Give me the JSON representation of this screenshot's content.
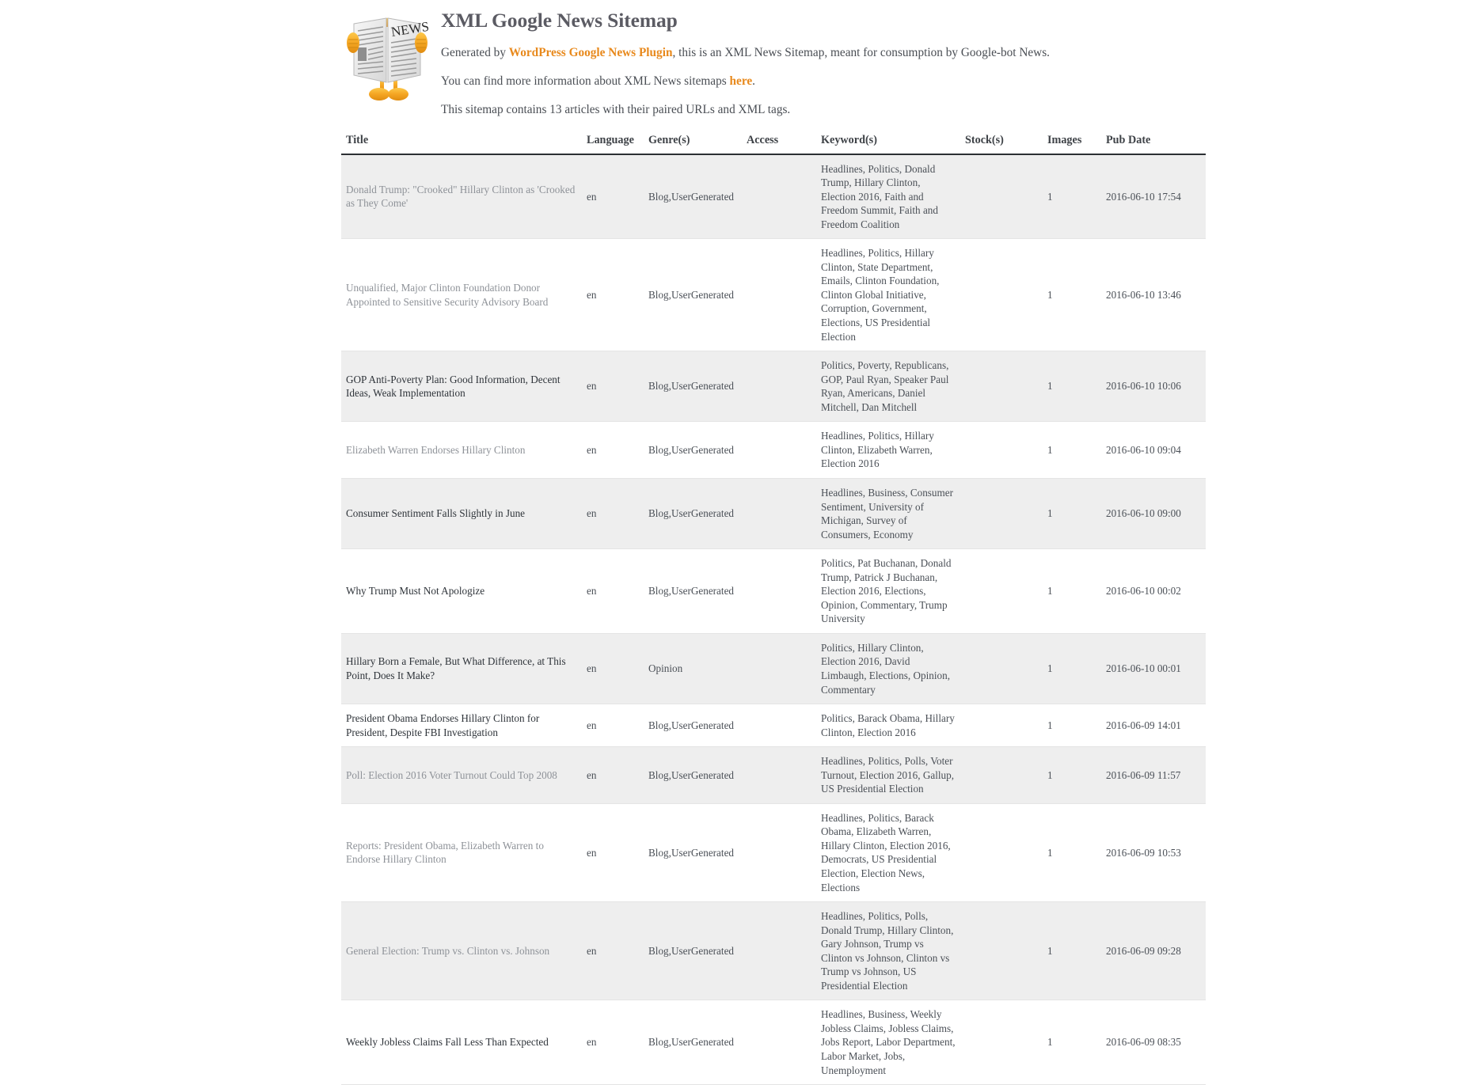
{
  "header": {
    "title": "XML Google News Sitemap",
    "mascot_alt": "news-mascot",
    "generated_prefix": "Generated by ",
    "generated_link": "WordPress Google News Plugin",
    "generated_suffix": ", this is an XML News Sitemap, meant for consumption by Google-bot News.",
    "more_info_prefix": "You can find more information about XML News sitemaps ",
    "more_info_link": "here",
    "more_info_suffix": ".",
    "count_line": "This sitemap contains 13 articles with their paired URLs and XML tags.",
    "accent_color": "#e8891c",
    "heading_color": "#5b5b63"
  },
  "table": {
    "columns": [
      "Title",
      "Language",
      "Genre(s)",
      "Access",
      "Keyword(s)",
      "Stock(s)",
      "Images",
      "Pub Date"
    ],
    "rows": [
      {
        "title": "Donald Trump: \"Crooked\" Hillary Clinton as 'Crooked as They Come'",
        "visited": true,
        "language": "en",
        "genres": "Blog,UserGenerated",
        "access": "",
        "keywords": "Headlines, Politics, Donald Trump, Hillary Clinton, Election 2016, Faith and Freedom Summit, Faith and Freedom Coalition",
        "stocks": "",
        "images": "1",
        "pub_date": "2016-06-10 17:54"
      },
      {
        "title": "Unqualified, Major Clinton Foundation Donor Appointed to Sensitive Security Advisory Board",
        "visited": true,
        "language": "en",
        "genres": "Blog,UserGenerated",
        "access": "",
        "keywords": "Headlines, Politics, Hillary Clinton, State Department, Emails, Clinton Foundation, Clinton Global Initiative, Corruption, Government, Elections, US Presidential Election",
        "stocks": "",
        "images": "1",
        "pub_date": "2016-06-10 13:46"
      },
      {
        "title": "GOP Anti-Poverty Plan: Good Information, Decent Ideas, Weak Implementation",
        "visited": false,
        "language": "en",
        "genres": "Blog,UserGenerated",
        "access": "",
        "keywords": "Politics, Poverty, Republicans, GOP, Paul Ryan, Speaker Paul Ryan, Americans, Daniel Mitchell, Dan Mitchell",
        "stocks": "",
        "images": "1",
        "pub_date": "2016-06-10 10:06"
      },
      {
        "title": "Elizabeth Warren Endorses Hillary Clinton",
        "visited": true,
        "language": "en",
        "genres": "Blog,UserGenerated",
        "access": "",
        "keywords": "Headlines, Politics, Hillary Clinton, Elizabeth Warren, Election 2016",
        "stocks": "",
        "images": "1",
        "pub_date": "2016-06-10 09:04"
      },
      {
        "title": "Consumer Sentiment Falls Slightly in June",
        "visited": false,
        "language": "en",
        "genres": "Blog,UserGenerated",
        "access": "",
        "keywords": "Headlines, Business, Consumer Sentiment, University of Michigan, Survey of Consumers, Economy",
        "stocks": "",
        "images": "1",
        "pub_date": "2016-06-10 09:00"
      },
      {
        "title": "Why Trump Must Not Apologize",
        "visited": false,
        "language": "en",
        "genres": "Blog,UserGenerated",
        "access": "",
        "keywords": "Politics, Pat Buchanan, Donald Trump, Patrick J Buchanan, Election 2016, Elections, Opinion, Commentary, Trump University",
        "stocks": "",
        "images": "1",
        "pub_date": "2016-06-10 00:02"
      },
      {
        "title": "Hillary Born a Female, But What Difference, at This Point, Does It Make?",
        "visited": false,
        "language": "en",
        "genres": "Opinion",
        "access": "",
        "keywords": "Politics, Hillary Clinton, Election 2016, David Limbaugh, Elections, Opinion, Commentary",
        "stocks": "",
        "images": "1",
        "pub_date": "2016-06-10 00:01"
      },
      {
        "title": "President Obama Endorses Hillary Clinton for President, Despite FBI Investigation",
        "visited": false,
        "language": "en",
        "genres": "Blog,UserGenerated",
        "access": "",
        "keywords": "Politics, Barack Obama, Hillary Clinton, Election 2016",
        "stocks": "",
        "images": "1",
        "pub_date": "2016-06-09 14:01"
      },
      {
        "title": "Poll: Election 2016 Voter Turnout Could Top 2008",
        "visited": true,
        "language": "en",
        "genres": "Blog,UserGenerated",
        "access": "",
        "keywords": "Headlines, Politics, Polls, Voter Turnout, Election 2016, Gallup, US Presidential Election",
        "stocks": "",
        "images": "1",
        "pub_date": "2016-06-09 11:57"
      },
      {
        "title": "Reports: President Obama, Elizabeth Warren to Endorse Hillary Clinton",
        "visited": true,
        "language": "en",
        "genres": "Blog,UserGenerated",
        "access": "",
        "keywords": "Headlines, Politics, Barack Obama, Elizabeth Warren, Hillary Clinton, Election 2016, Democrats, US Presidential Election, Election News, Elections",
        "stocks": "",
        "images": "1",
        "pub_date": "2016-06-09 10:53"
      },
      {
        "title": "General Election: Trump vs. Clinton vs. Johnson",
        "visited": true,
        "language": "en",
        "genres": "Blog,UserGenerated",
        "access": "",
        "keywords": "Headlines, Politics, Polls, Donald Trump, Hillary Clinton, Gary Johnson, Trump vs Clinton vs Johnson, Clinton vs Trump vs Johnson, US Presidential Election",
        "stocks": "",
        "images": "1",
        "pub_date": "2016-06-09 09:28"
      },
      {
        "title": "Weekly Jobless Claims Fall Less Than Expected",
        "visited": false,
        "language": "en",
        "genres": "Blog,UserGenerated",
        "access": "",
        "keywords": "Headlines, Business, Weekly Jobless Claims, Jobless Claims, Jobs Report, Labor Department, Labor Market, Jobs, Unemployment",
        "stocks": "",
        "images": "1",
        "pub_date": "2016-06-09 08:35"
      }
    ]
  }
}
